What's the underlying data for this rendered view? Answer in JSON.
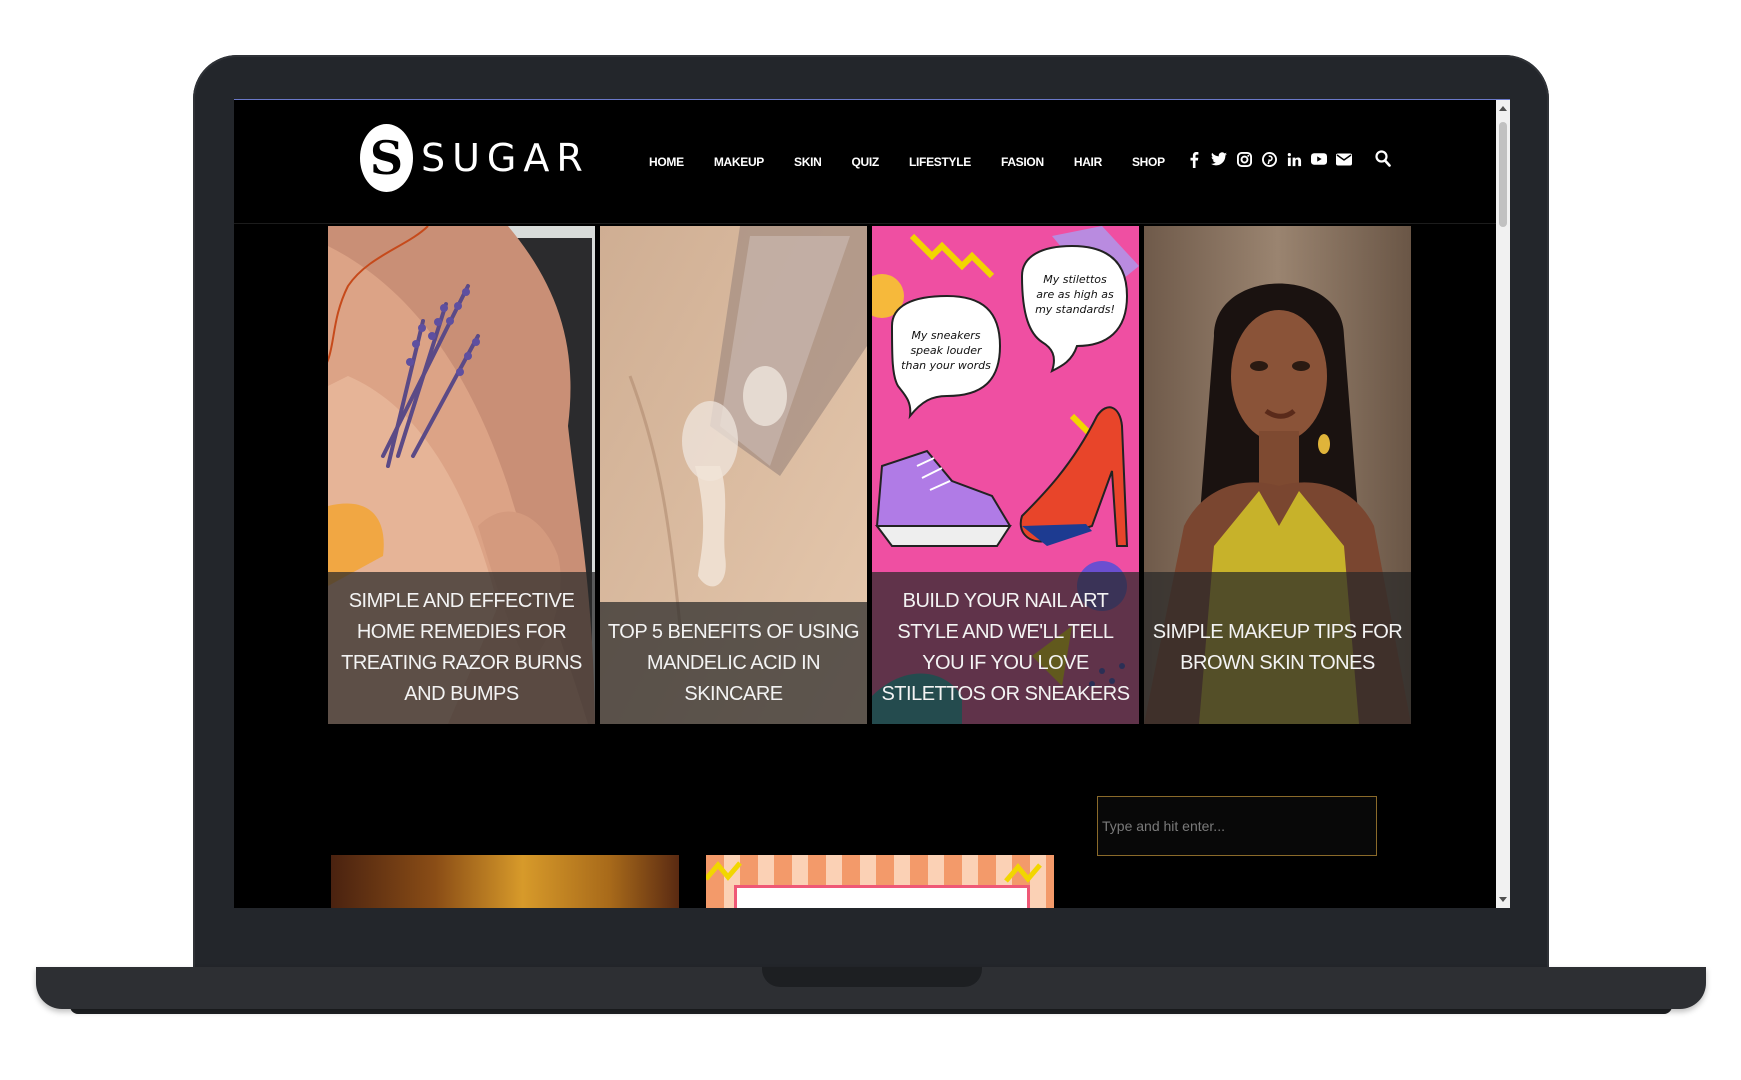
{
  "site": {
    "logo_letter": "S",
    "logo_text": "SUGAR"
  },
  "nav": {
    "items": [
      {
        "label": "HOME"
      },
      {
        "label": "MAKEUP"
      },
      {
        "label": "SKIN"
      },
      {
        "label": "QUIZ"
      },
      {
        "label": "LIFESTYLE"
      },
      {
        "label": "FASION"
      },
      {
        "label": "HAIR"
      },
      {
        "label": "SHOP"
      }
    ]
  },
  "social": {
    "icons": [
      "facebook-icon",
      "twitter-icon",
      "instagram-icon",
      "pinterest-icon",
      "linkedin-icon",
      "youtube-icon",
      "email-icon"
    ]
  },
  "cards": [
    {
      "title": "SIMPLE AND EFFECTIVE HOME REMEDIES FOR TREATING RAZOR BURNS AND BUMPS"
    },
    {
      "title": "TOP 5 BENEFITS OF USING MANDELIC ACID IN SKINCARE"
    },
    {
      "title": "BUILD YOUR NAIL ART STYLE AND WE'LL TELL YOU IF YOU LOVE STILETTOS OR SNEAKERS",
      "bubble_left": "My sneakers speak louder than your words",
      "bubble_right": "My stilettos are as high as my standards!"
    },
    {
      "title": "SIMPLE MAKEUP TIPS FOR BROWN SKIN TONES"
    }
  ],
  "sidebar": {
    "search_placeholder": "Type and hit enter..."
  },
  "colors": {
    "page_bg": "#000000",
    "accent_border": "#8a6a2a",
    "frame": "#23262b"
  }
}
